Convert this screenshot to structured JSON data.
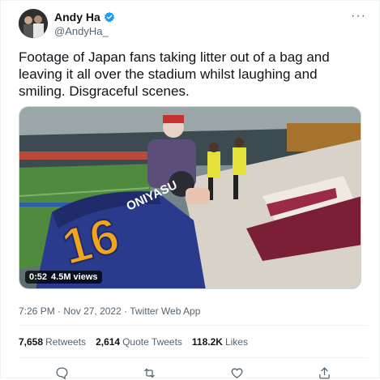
{
  "author": {
    "name": "Andy Ha",
    "handle": "@AndyHa_"
  },
  "tweet": {
    "text": "Footage of Japan fans taking litter out of a bag and leaving it all over the stadium whilst laughing and smiling. Disgraceful scenes."
  },
  "video": {
    "duration": "0:52",
    "views": "4.5M views",
    "jersey_name": "ONIYASU",
    "jersey_number": "16"
  },
  "meta": {
    "time": "7:26 PM",
    "separator": "·",
    "date": "Nov 27, 2022",
    "source": "Twitter Web App"
  },
  "stats": {
    "retweets_count": "7,658",
    "retweets_label": "Retweets",
    "quotes_count": "2,614",
    "quotes_label": "Quote Tweets",
    "likes_count": "118.2K",
    "likes_label": "Likes"
  },
  "actions": [
    "reply-icon",
    "retweet-icon",
    "like-icon",
    "share-icon"
  ],
  "colors": {
    "verified": "#1d9bf0",
    "muted": "#536471",
    "text": "#0f1419",
    "jersey": "#2a3a8c",
    "number": "#f2a41c",
    "seat": "#7a1f36"
  }
}
